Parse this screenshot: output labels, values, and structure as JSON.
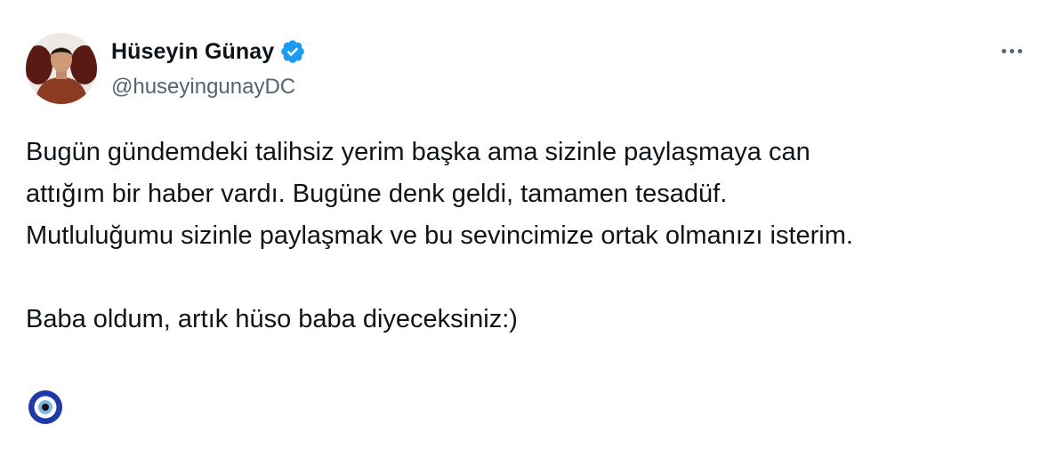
{
  "author": {
    "display_name": "Hüseyin Günay",
    "handle": "@huseyingunayDC",
    "verified": true,
    "avatar_icon": "user-avatar-photo"
  },
  "menu": {
    "more_icon": "more-horizontal-icon"
  },
  "tweet": {
    "lines": [
      "Bugün gündemdeki talihsiz yerim başka ama sizinle paylaşmaya can",
      "attığım bir haber vardı. Bugüne denk geldi, tamamen tesadüf.",
      "Mutluluğumu sizinle paylaşmak ve bu sevincimize ortak olmanızı isterim.",
      "",
      "Baba oldum, artık hüso baba diyeceksiniz:)"
    ],
    "emoji": "🧿",
    "emoji_icon": "nazar-evil-eye-icon"
  },
  "colors": {
    "text": "#0f1419",
    "secondary": "#536471",
    "verified_blue": "#1d9bf0",
    "background": "#ffffff"
  }
}
